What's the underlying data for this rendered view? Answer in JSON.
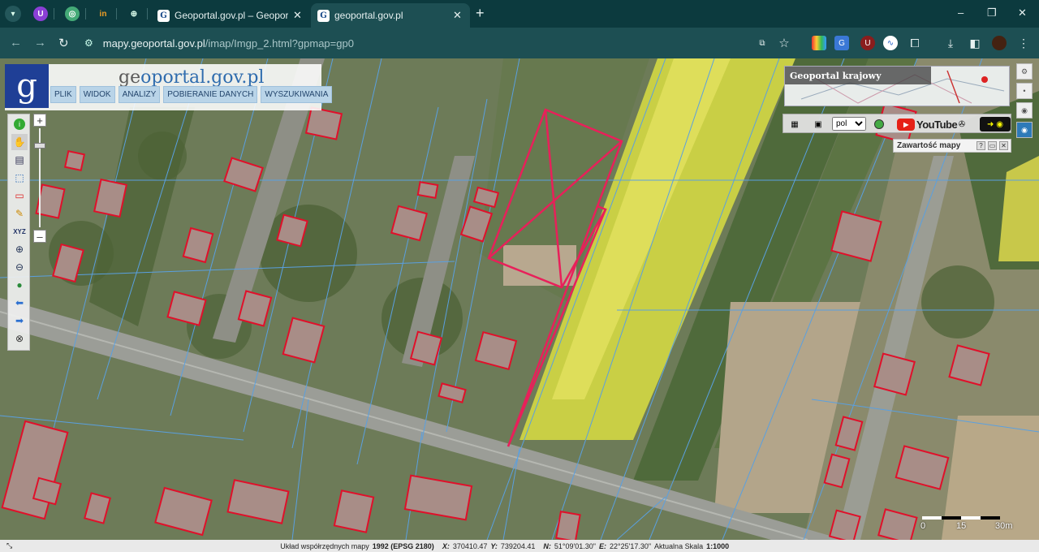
{
  "browser": {
    "tabs": [
      {
        "title": "Geoportal.gov.pl – Geoportal Inf",
        "favicon": "G",
        "active": false
      },
      {
        "title": "geoportal.gov.pl",
        "favicon": "G",
        "active": true
      }
    ],
    "pinned_icons": [
      "menu-icon",
      "ublock-icon",
      "chatgpt-icon",
      "linkedin-icon",
      "globe-icon"
    ],
    "pinned_labels": {
      "linkedin": "in"
    },
    "new_tab": "+",
    "url_host": "mapy.geoportal.gov.pl",
    "url_path": "/imap/Imgp_2.html?gpmap=gp0",
    "window_controls": [
      "–",
      "❐",
      "✕"
    ]
  },
  "portal": {
    "logo_text_a": "ge",
    "logo_text_b": "oportal.gov.pl",
    "menu": [
      "PLIK",
      "WIDOK",
      "ANALIZY",
      "POBIERANIE DANYCH",
      "WYSZUKIWANIA"
    ],
    "overview_title": "Geoportal krajowy",
    "language": "pol",
    "youtube_label": "YouTube",
    "content_panel_title": "Zawartość mapy",
    "content_panel_buttons": [
      "?",
      "▭",
      "✕"
    ],
    "zoom_in": "+",
    "zoom_out": "–"
  },
  "scale_bar": {
    "labels": [
      "0",
      "15",
      "30m"
    ]
  },
  "status": {
    "crs_label": "Układ współrzędnych mapy",
    "crs_value": "1992 (EPSG 2180)",
    "x_label": "X:",
    "x_value": "370410.47",
    "y_label": "Y:",
    "y_value": "739204.41",
    "n_label": "N:",
    "n_value": "51°09'01.30\"",
    "e_label": "E:",
    "e_value": "22°25'17.30\"",
    "scale_label": "Aktualna Skala",
    "scale_value": "1:1000"
  },
  "colors": {
    "chrome_bg": "#0c3a3e",
    "address_bg": "#1d4f53",
    "parcel_line": "#5aa0e0",
    "building_outline": "#e0102a",
    "selection_outline": "#e8205a",
    "rapeseed_field": "#d6d64a"
  }
}
